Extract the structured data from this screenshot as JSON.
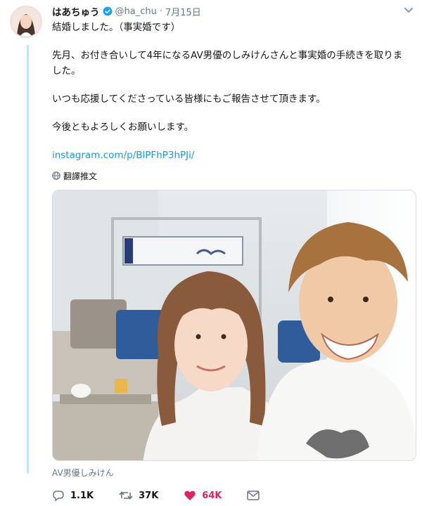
{
  "tweet": {
    "display_name": "はあちゅう",
    "handle": "@ha_chu",
    "separator": "·",
    "date": "7月15日",
    "text_lines": [
      "結婚しました。（事実婚です）",
      "先月、お付き合いして4年になるAV男優のしみけんさんと事実婚の手続きを取りました。",
      "いつも応援してくださっている皆様にもご報告させて頂きます。",
      "今後ともよろしくお願いします。"
    ],
    "link": "instagram.com/p/BlPFhP3hPJi/",
    "translate_label": "翻譯推文",
    "media_caption": "AV男優しみけん"
  },
  "actions": {
    "reply_count": "1.1K",
    "retweet_count": "37K",
    "like_count": "64K"
  },
  "colors": {
    "link": "#1b95e0",
    "like": "#e0245e",
    "meta": "#657786",
    "thread_line": "#c4e3f5"
  },
  "icons": [
    "verified-badge-icon",
    "caret-down-icon",
    "globe-icon",
    "reply-icon",
    "retweet-icon",
    "heart-icon",
    "dm-icon"
  ]
}
